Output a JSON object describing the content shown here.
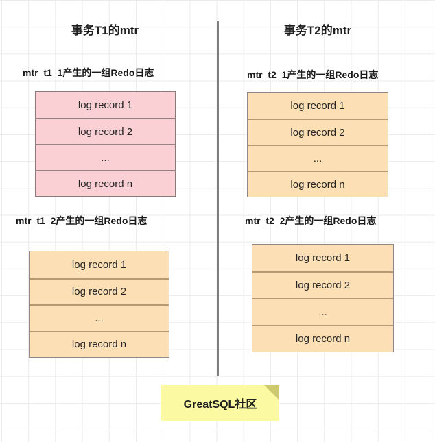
{
  "diagram": {
    "columns": [
      {
        "header": "事务T1的mtr",
        "groups": [
          {
            "caption": "mtr_t1_1产生的一组Redo日志",
            "color": "#fbd0d4",
            "records": [
              "log record 1",
              "log record 2",
              "...",
              "log record n"
            ]
          },
          {
            "caption": "mtr_t1_2产生的一组Redo日志",
            "color": "#fcdfb4",
            "records": [
              "log record 1",
              "log record 2",
              "...",
              "log record n"
            ]
          }
        ]
      },
      {
        "header": "事务T2的mtr",
        "groups": [
          {
            "caption": "mtr_t2_1产生的一组Redo日志",
            "color": "#fcdfb4",
            "records": [
              "log record 1",
              "log record 2",
              "...",
              "log record n"
            ]
          },
          {
            "caption": "mtr_t2_2产生的一组Redo日志",
            "color": "#fcdfb4",
            "records": [
              "log record 1",
              "log record 2",
              "...",
              "log record n"
            ]
          }
        ]
      }
    ],
    "divider": {
      "name": "vertical-divider",
      "color": "#7f7f7f"
    },
    "watermark": {
      "label": "GreatSQL社区",
      "background": "#fbfaa3",
      "fold": "#cdc96f"
    },
    "background": {
      "grid_color": "#ebebeb",
      "page_color": "#ffffff"
    }
  }
}
